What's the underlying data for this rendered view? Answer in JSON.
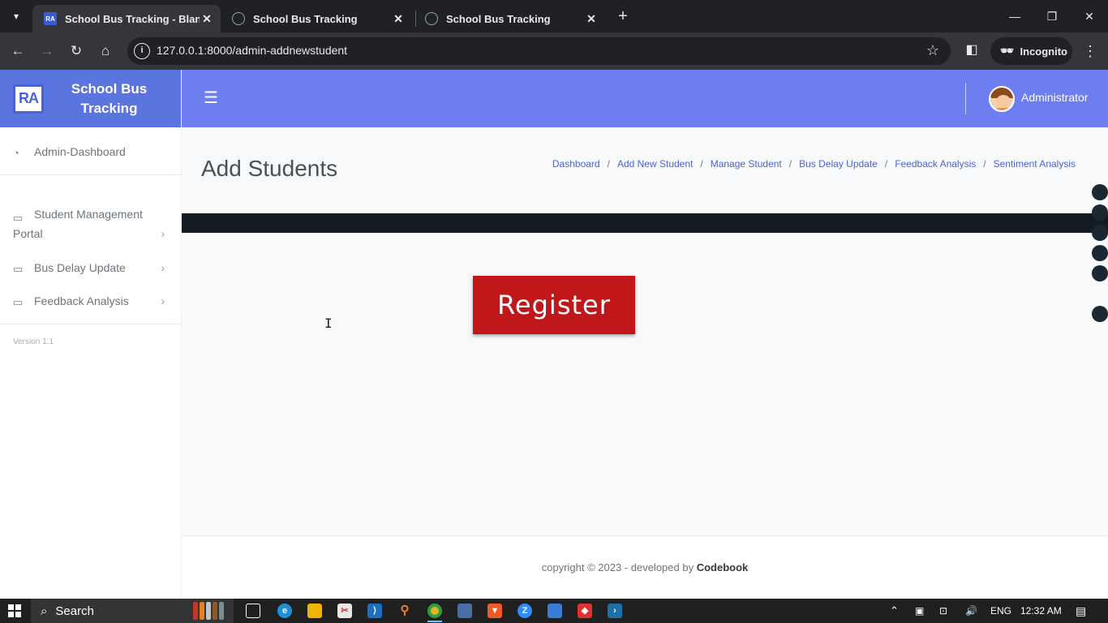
{
  "browser": {
    "tabs": [
      {
        "title": "School Bus Tracking - Blank Page",
        "active": true,
        "favicon": "ra-logo-icon"
      },
      {
        "title": "School Bus Tracking",
        "active": false,
        "favicon": "globe-icon"
      },
      {
        "title": "School Bus Tracking",
        "active": false,
        "favicon": "globe-icon"
      }
    ],
    "close_glyph": "✕",
    "new_tab_glyph": "+",
    "url": "127.0.0.1:8000/admin-addnewstudent",
    "incognito_label": "Incognito"
  },
  "sidebar": {
    "brand_logo": "RA",
    "brand_line1": "School Bus",
    "brand_line2": "Tracking",
    "dashboard_label": "Admin-Dashboard",
    "items": [
      {
        "label_line1": "Student Management",
        "label_line2": "Portal"
      },
      {
        "label": "Bus Delay Update"
      },
      {
        "label": "Feedback Analysis"
      }
    ],
    "version": "Version 1.1"
  },
  "header": {
    "admin_name": "Administrator"
  },
  "page": {
    "title": "Add Students",
    "breadcrumb": [
      "Dashboard",
      "Add New Student",
      "Manage Student",
      "Bus Delay Update",
      "Feedback Analysis",
      "Sentiment Analysis"
    ],
    "breadcrumb_sep": "/",
    "register_label": "Register"
  },
  "footer": {
    "text": "copyright © 2023 - developed by ",
    "brand": "Codebook"
  },
  "taskbar": {
    "search_label": "Search",
    "language": "ENG",
    "time": "12:32 AM"
  },
  "colors": {
    "brand_blue": "#5a74e0",
    "header_blue": "#6d7ff0",
    "link_blue": "#4c63d2",
    "register_red": "#c0171b",
    "dark_band": "#151b22"
  }
}
